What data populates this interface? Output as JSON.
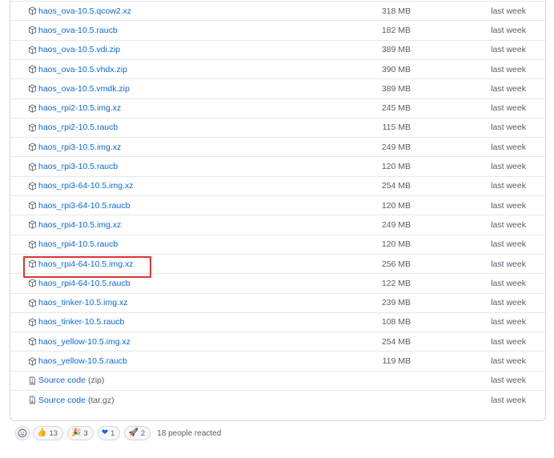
{
  "assets": [
    {
      "name": "haos_ova-10.5.qcow2.xz",
      "size": "318 MB",
      "time": "last week",
      "icon": "package-icon"
    },
    {
      "name": "haos_ova-10.5.raucb",
      "size": "182 MB",
      "time": "last week",
      "icon": "package-icon"
    },
    {
      "name": "haos_ova-10.5.vdi.zip",
      "size": "389 MB",
      "time": "last week",
      "icon": "package-icon"
    },
    {
      "name": "haos_ova-10.5.vhdx.zip",
      "size": "390 MB",
      "time": "last week",
      "icon": "package-icon"
    },
    {
      "name": "haos_ova-10.5.vmdk.zip",
      "size": "389 MB",
      "time": "last week",
      "icon": "package-icon"
    },
    {
      "name": "haos_rpi2-10.5.img.xz",
      "size": "245 MB",
      "time": "last week",
      "icon": "package-icon"
    },
    {
      "name": "haos_rpi2-10.5.raucb",
      "size": "115 MB",
      "time": "last week",
      "icon": "package-icon"
    },
    {
      "name": "haos_rpi3-10.5.img.xz",
      "size": "249 MB",
      "time": "last week",
      "icon": "package-icon"
    },
    {
      "name": "haos_rpi3-10.5.raucb",
      "size": "120 MB",
      "time": "last week",
      "icon": "package-icon"
    },
    {
      "name": "haos_rpi3-64-10.5.img.xz",
      "size": "254 MB",
      "time": "last week",
      "icon": "package-icon"
    },
    {
      "name": "haos_rpi3-64-10.5.raucb",
      "size": "120 MB",
      "time": "last week",
      "icon": "package-icon"
    },
    {
      "name": "haos_rpi4-10.5.img.xz",
      "size": "249 MB",
      "time": "last week",
      "icon": "package-icon"
    },
    {
      "name": "haos_rpi4-10.5.raucb",
      "size": "120 MB",
      "time": "last week",
      "icon": "package-icon"
    },
    {
      "name": "haos_rpi4-64-10.5.img.xz",
      "size": "256 MB",
      "time": "last week",
      "icon": "package-icon",
      "highlighted": true
    },
    {
      "name": "haos_rpi4-64-10.5.raucb",
      "size": "122 MB",
      "time": "last week",
      "icon": "package-icon"
    },
    {
      "name": "haos_tinker-10.5.img.xz",
      "size": "239 MB",
      "time": "last week",
      "icon": "package-icon"
    },
    {
      "name": "haos_tinker-10.5.raucb",
      "size": "108 MB",
      "time": "last week",
      "icon": "package-icon"
    },
    {
      "name": "haos_yellow-10.5.img.xz",
      "size": "254 MB",
      "time": "last week",
      "icon": "package-icon"
    },
    {
      "name": "haos_yellow-10.5.raucb",
      "size": "119 MB",
      "time": "last week",
      "icon": "package-icon"
    },
    {
      "name": "Source code",
      "suffix": "(zip)",
      "size": "",
      "time": "last week",
      "icon": "file-zip-icon"
    },
    {
      "name": "Source code",
      "suffix": "(tar.gz)",
      "size": "",
      "time": "last week",
      "icon": "file-zip-icon"
    }
  ],
  "reactions": {
    "items": [
      {
        "emoji": "👍",
        "count": "13",
        "name": "thumbs-up"
      },
      {
        "emoji": "🎉",
        "count": "3",
        "name": "tada"
      },
      {
        "emoji": "❤",
        "count": "1",
        "name": "heart"
      },
      {
        "emoji": "🚀",
        "count": "2",
        "name": "rocket"
      }
    ],
    "summary": "18 people reacted"
  },
  "colors": {
    "link": "#0969da",
    "muted": "#57606a",
    "border": "#d0d7de",
    "highlight": "#d93636"
  }
}
